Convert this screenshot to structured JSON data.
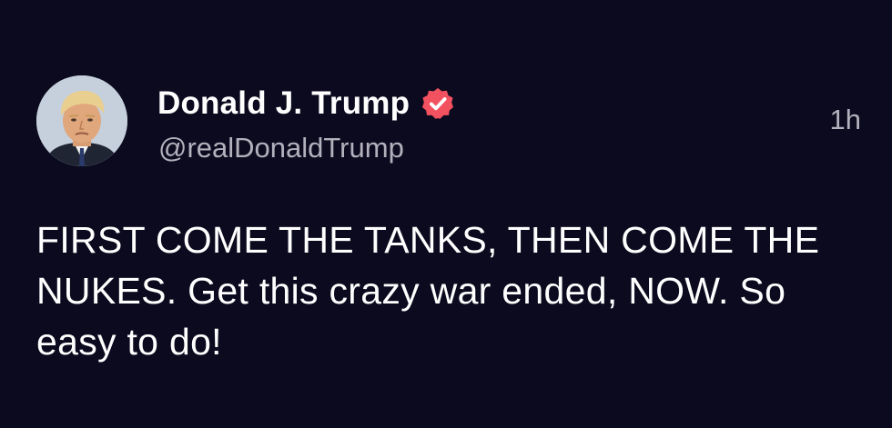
{
  "author": {
    "display_name": "Donald J. Trump",
    "handle": "@realDonaldTrump",
    "verified": true
  },
  "timestamp": "1h",
  "post": {
    "text": "FIRST COME THE TANKS, THEN COME THE NUKES. Get this crazy war ended, NOW. So easy to do!"
  },
  "colors": {
    "background": "#0c0a1e",
    "text_primary": "#ffffff",
    "text_secondary": "#b3b1bd",
    "verified_badge": "#f2515f"
  },
  "icons": {
    "avatar": "profile-photo",
    "verified": "verified-badge-icon"
  }
}
